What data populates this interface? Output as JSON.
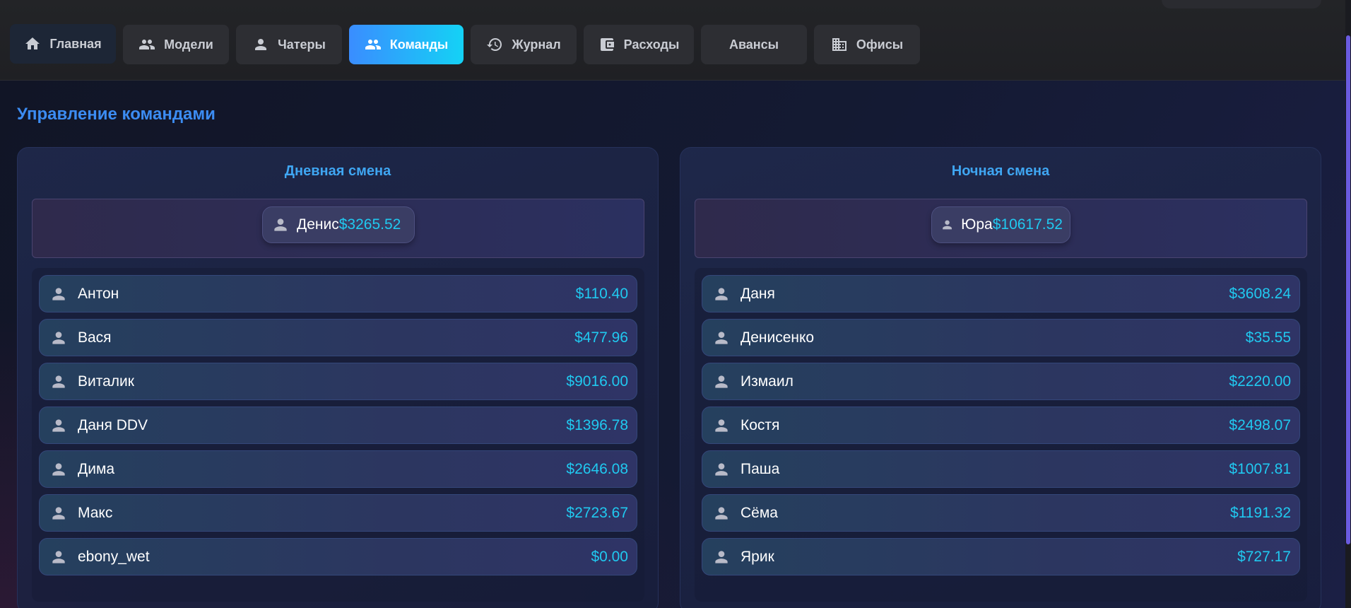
{
  "nav": {
    "tabs": [
      {
        "label": "Главная",
        "icon": "home-icon"
      },
      {
        "label": "Модели",
        "icon": "group-icon"
      },
      {
        "label": "Чатеры",
        "icon": "person-icon"
      },
      {
        "label": "Команды",
        "icon": "group-icon",
        "active": true
      },
      {
        "label": "Журнал",
        "icon": "history-icon"
      },
      {
        "label": "Расходы",
        "icon": "wallet-icon"
      },
      {
        "label": "Авансы",
        "icon": ""
      },
      {
        "label": "Офисы",
        "icon": "building-icon"
      }
    ]
  },
  "page": {
    "title": "Управление командами"
  },
  "day_shift": {
    "title": "Дневная смена",
    "leader": {
      "name": "Денис",
      "amount": "$3265.52"
    },
    "members": [
      {
        "name": "Антон",
        "amount": "$110.40"
      },
      {
        "name": "Вася",
        "amount": "$477.96"
      },
      {
        "name": "Виталик",
        "amount": "$9016.00"
      },
      {
        "name": "Даня DDV",
        "amount": "$1396.78"
      },
      {
        "name": "Дима",
        "amount": "$2646.08"
      },
      {
        "name": "Макс",
        "amount": "$2723.67"
      },
      {
        "name": "ebony_wet",
        "amount": "$0.00"
      }
    ]
  },
  "night_shift": {
    "title": "Ночная смена",
    "leader": {
      "name": "Юра",
      "amount": "$10617.52"
    },
    "members": [
      {
        "name": "Даня",
        "amount": "$3608.24"
      },
      {
        "name": "Денисенко",
        "amount": "$35.55"
      },
      {
        "name": "Измаил",
        "amount": "$2220.00"
      },
      {
        "name": "Костя",
        "amount": "$2498.07"
      },
      {
        "name": "Паша",
        "amount": "$1007.81"
      },
      {
        "name": "Сёма",
        "amount": "$1191.32"
      },
      {
        "name": "Ярик",
        "amount": "$727.17"
      }
    ]
  },
  "colors": {
    "accent": "#3a8dff",
    "amount": "#20c9f0",
    "title": "#3c8cf2"
  }
}
